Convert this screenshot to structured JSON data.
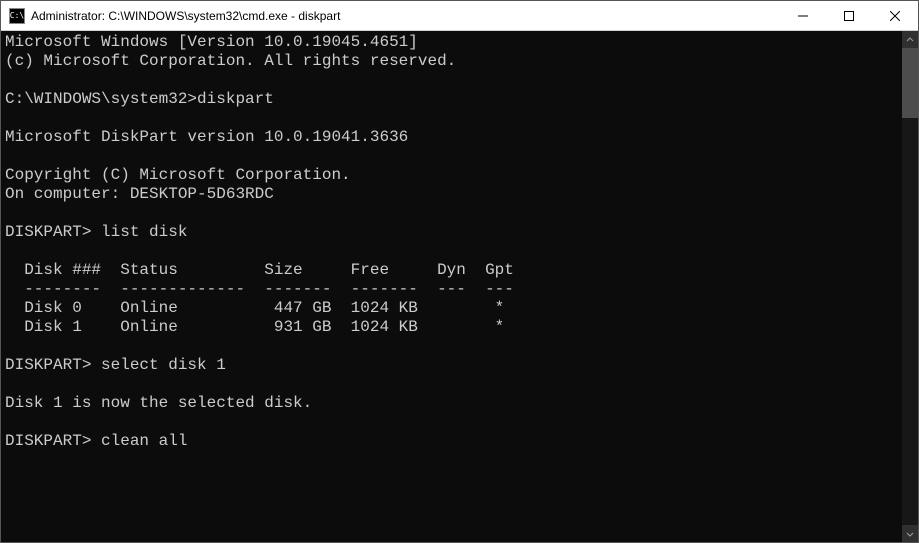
{
  "titlebar": {
    "icon_label": "C:\\",
    "title": "Administrator: C:\\WINDOWS\\system32\\cmd.exe - diskpart"
  },
  "console": {
    "lines": [
      "Microsoft Windows [Version 10.0.19045.4651]",
      "(c) Microsoft Corporation. All rights reserved.",
      "",
      "C:\\WINDOWS\\system32>diskpart",
      "",
      "Microsoft DiskPart version 10.0.19041.3636",
      "",
      "Copyright (C) Microsoft Corporation.",
      "On computer: DESKTOP-5D63RDC",
      "",
      "DISKPART> list disk",
      "",
      "  Disk ###  Status         Size     Free     Dyn  Gpt",
      "  --------  -------------  -------  -------  ---  ---",
      "  Disk 0    Online          447 GB  1024 KB        *",
      "  Disk 1    Online          931 GB  1024 KB        *",
      "",
      "DISKPART> select disk 1",
      "",
      "Disk 1 is now the selected disk.",
      "",
      "DISKPART> clean all"
    ]
  }
}
